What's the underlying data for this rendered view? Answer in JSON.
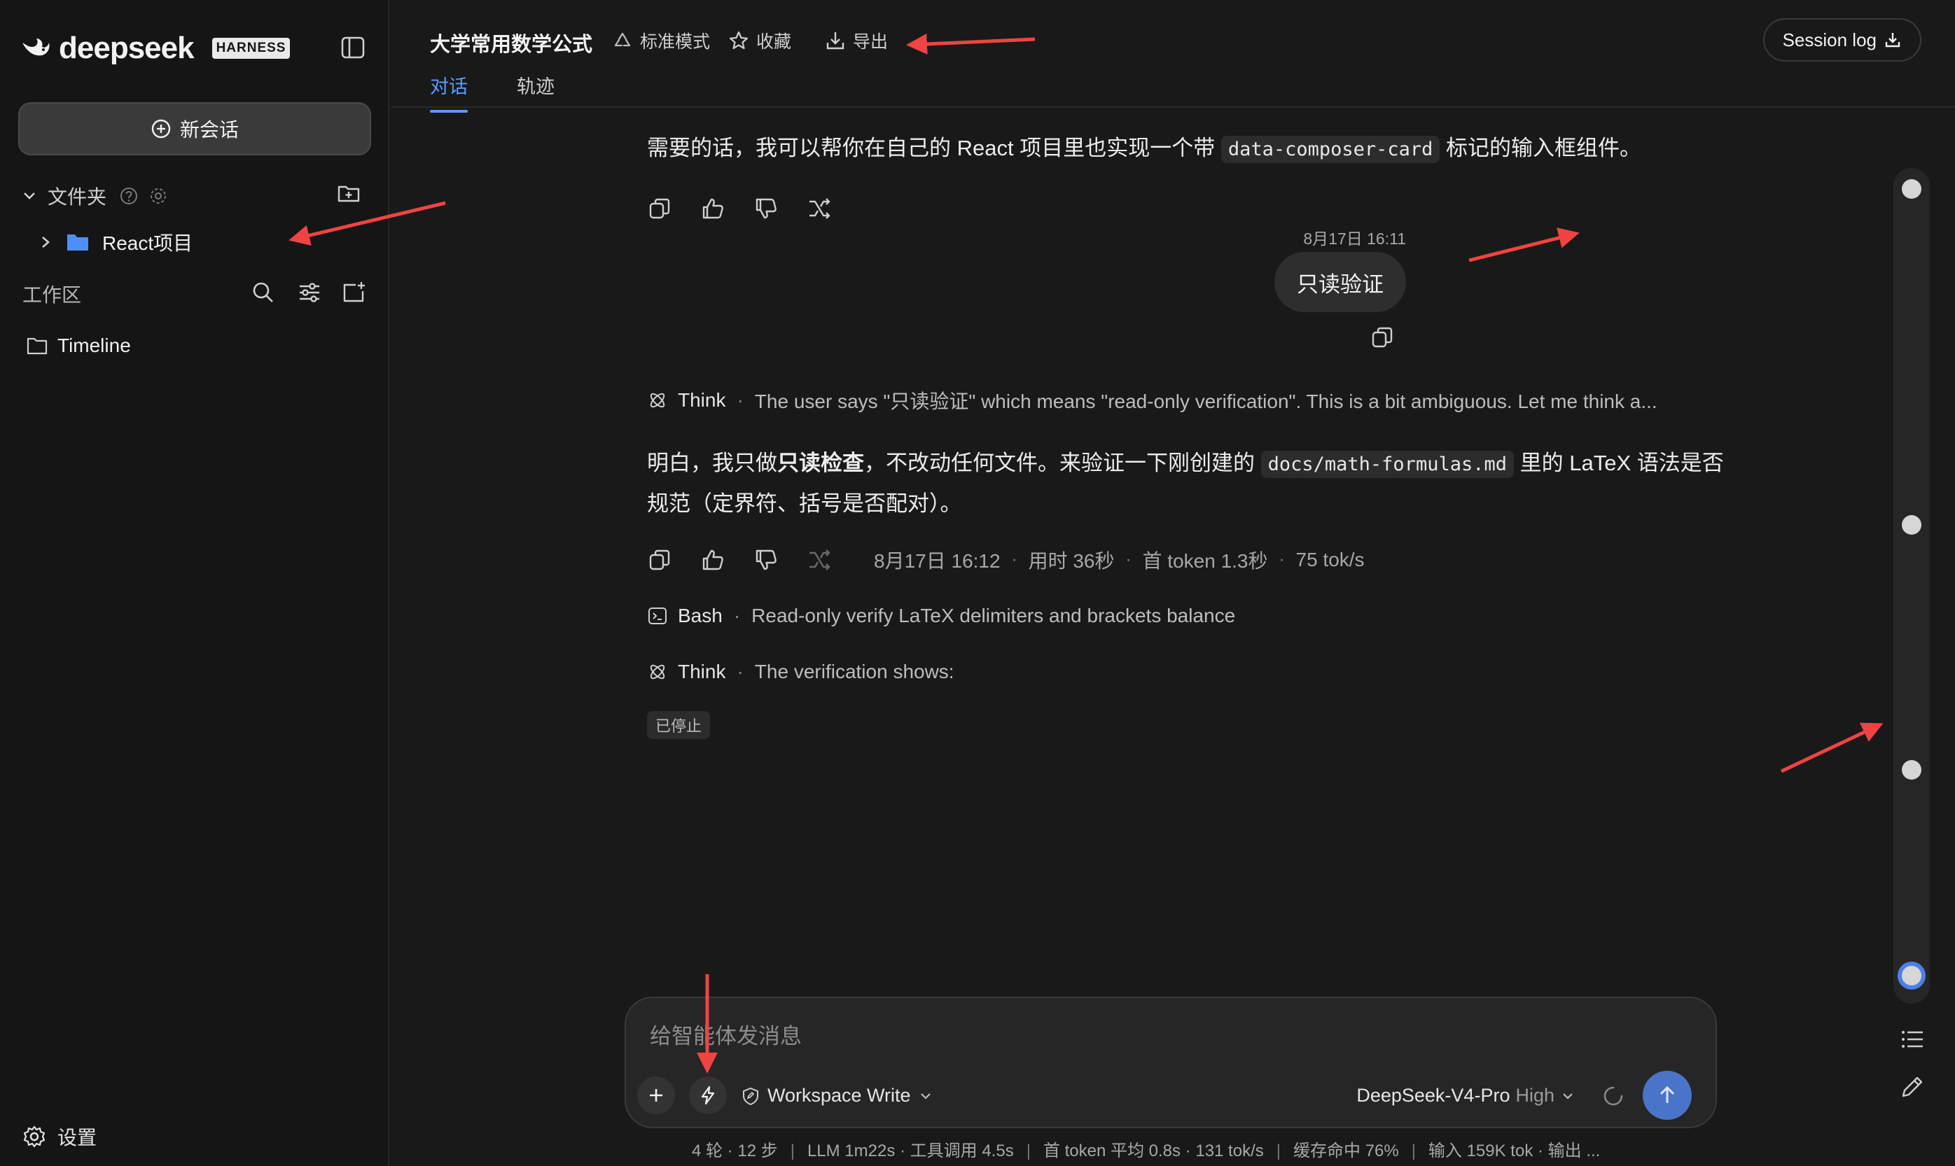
{
  "sidebar": {
    "brand": "deepseek",
    "brand_badge": "HARNESS",
    "new_chat_label": "新会话",
    "folders_label": "文件夹",
    "folder_item": "React项目",
    "workspace_label": "工作区",
    "workspace_item": "Timeline",
    "settings_label": "设置"
  },
  "header": {
    "title": "大学常用数学公式",
    "mode_label": "标准模式",
    "favorite_label": "收藏",
    "export_label": "导出",
    "tabs": [
      {
        "label": "对话",
        "active": true
      },
      {
        "label": "轨迹",
        "active": false
      }
    ],
    "session_log_label": "Session log"
  },
  "conversation": {
    "msg1_before": "需要的话，我可以帮你在自己的 React 项目里也实现一个带 ",
    "msg1_code": "data-composer-card",
    "msg1_after": " 标记的输入框组件。",
    "user_time": "8月17日 16:11",
    "user_message": "只读验证",
    "think1_label": "Think",
    "think1_text": "The user says \"只读验证\" which means \"read-only verification\". This is a bit ambiguous. Let me think a...",
    "msg2_part1": "明白，我只做",
    "msg2_bold": "只读检查",
    "msg2_part2": "，不改动任何文件。来验证一下刚创建的 ",
    "msg2_code": "docs/math-formulas.md",
    "msg2_part3": " 里的 LaTeX 语法是否规范（定界符、括号是否配对）。",
    "meta": {
      "time": "8月17日 16:12",
      "duration": "用时 36秒",
      "first_token": "首 token 1.3秒",
      "speed": "75 tok/s"
    },
    "bash_label": "Bash",
    "bash_text": "Read-only verify LaTeX delimiters and brackets balance",
    "think2_label": "Think",
    "think2_text": "The verification shows:",
    "stopped_label": "已停止"
  },
  "composer": {
    "placeholder": "给智能体发消息",
    "permission_label": "Workspace Write",
    "model_label": "DeepSeek-V4-Pro",
    "effort_label": "High"
  },
  "statusbar": {
    "turns": "4 轮 · 12 步",
    "timing": "LLM 1m22s · 工具调用 4.5s",
    "token_avg": "首 token 平均 0.8s · 131 tok/s",
    "cache": "缓存命中 76%",
    "io": "输入 159K tok · 输出 ..."
  },
  "colors": {
    "accent": "#5b9cff",
    "send_button": "#4a74c8",
    "annotation_arrow": "#f04343",
    "folder_icon": "#4f8ef7"
  }
}
